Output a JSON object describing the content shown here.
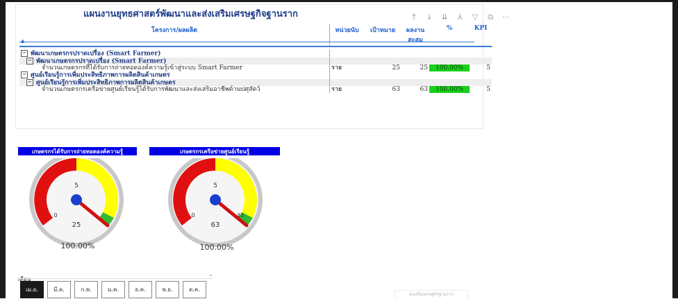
{
  "report": {
    "title": "แผนงานยุทธศาสตร์พัฒนาและส่งเสริมเศรษฐกิจฐานราก"
  },
  "toolbar": {
    "icons": [
      "arrow-up-icon",
      "arrow-down-icon",
      "expand-all-icon",
      "drill-icon",
      "filter-icon",
      "focus-mode-icon",
      "more-options-icon"
    ],
    "glyphs": [
      "↑",
      "↓",
      "⇊",
      "⅄",
      "▽",
      "⧉",
      "⋯"
    ]
  },
  "table": {
    "columns": [
      "โครงการ/ผลผลิต",
      "หน่วยนับ",
      "เป้าหมาย",
      "ผลงานสะสม",
      "%",
      "KPI"
    ],
    "rows": [
      {
        "level": 1,
        "label": "พัฒนาเกษตรกรปราดเปรื่อง (Smart Farmer)",
        "unit": "",
        "target": "",
        "cumulative": "",
        "pct": "",
        "kpi": ""
      },
      {
        "level": 2,
        "label": "พัฒนาเกษตรกรปราดเปรื่อง (Smart Farmer)",
        "unit": "",
        "target": "",
        "cumulative": "",
        "pct": "",
        "kpi": ""
      },
      {
        "level": 3,
        "label": "จำนวนเกษตรกรที่ได้รับการถ่ายทอดองค์ความรู้เข้าสู่ระบบ Smart Farmer",
        "unit": "ราย",
        "target": "25",
        "cumulative": "25",
        "pct": "100.00%",
        "kpi": "5"
      },
      {
        "level": 1,
        "label": "ศูนย์เรียนรู้การเพิ่มประสิทธิภาพการผลิตสินค้าเกษตร",
        "unit": "",
        "target": "",
        "cumulative": "",
        "pct": "",
        "kpi": ""
      },
      {
        "level": 2,
        "label": "ศูนย์เรียนรู้การเพิ่มประสิทธิภาพการผลิตสินค้าเกษตร",
        "unit": "",
        "target": "",
        "cumulative": "",
        "pct": "",
        "kpi": ""
      },
      {
        "level": 3,
        "label": "จำนวนเกษตรกรเครือข่ายศูนย์เรียนรู้ได้รับการพัฒนาและส่งเสริมอาชีพด้านปศุสัตว์",
        "unit": "ราย",
        "target": "63",
        "cumulative": "63",
        "pct": "100.00%",
        "kpi": "5"
      }
    ],
    "pct_highlight_color": "#1ad01a"
  },
  "gauges": [
    {
      "title": "เกษตรกรได้รับการถ่ายทอดองค์ความรู้",
      "min": "0",
      "max": "20",
      "mid": "5",
      "value": "25",
      "percent": "100.00%",
      "fraction": 1.0
    },
    {
      "title": "เกษตรกรเครือข่ายศูนย์เรียนรู้",
      "min": "0",
      "max": "40",
      "mid": "5",
      "value": "63",
      "percent": "100.00%",
      "fraction": 1.0
    }
  ],
  "filter": {
    "label": "เดือน",
    "months": [
      "เม.ย.",
      "มี.ค.",
      "ก.พ.",
      "ม.ค.",
      "ธ.ค.",
      "พ.ย.",
      "ต.ค."
    ],
    "selected": "เม.ย."
  },
  "footer": {
    "button_label": "ส่งเสริมเศรษฐกิจฐานราก"
  },
  "colors": {
    "header_blue": "#0000e6",
    "gauge_red": "#e01010",
    "gauge_yellow": "#ffff00",
    "gauge_green": "#33b833",
    "title_blue": "#1f3c88"
  }
}
